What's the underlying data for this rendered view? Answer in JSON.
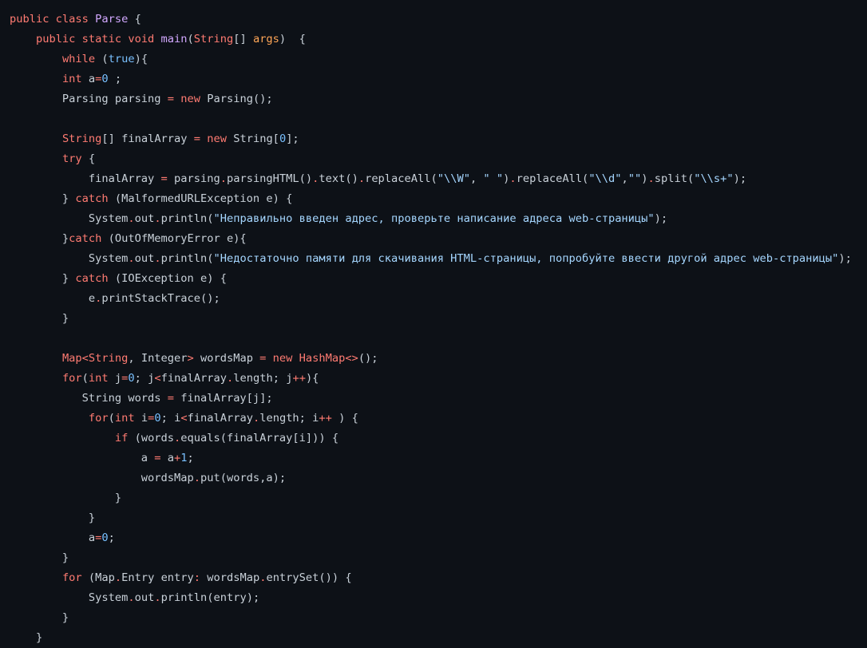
{
  "language": "java",
  "colors": {
    "background": "#0d1117",
    "text": "#c9d1d9",
    "keyword": "#ff7b72",
    "class_name": "#d2a8ff",
    "string": "#a5d6ff",
    "number": "#79c0ff",
    "argument": "#ffa657"
  },
  "lines": [
    [
      [
        "kw",
        "public class "
      ],
      [
        "cls",
        "Parse"
      ],
      [
        "p",
        " {"
      ]
    ],
    [
      [
        "p",
        "    "
      ],
      [
        "kw",
        "public static void "
      ],
      [
        "cls",
        "main"
      ],
      [
        "p",
        "("
      ],
      [
        "kw",
        "String"
      ],
      [
        "p",
        "[] "
      ],
      [
        "arg",
        "args"
      ],
      [
        "p",
        ")  {"
      ]
    ],
    [
      [
        "p",
        "        "
      ],
      [
        "kw",
        "while"
      ],
      [
        "p",
        " ("
      ],
      [
        "num",
        "true"
      ],
      [
        "p",
        "){"
      ]
    ],
    [
      [
        "p",
        "        "
      ],
      [
        "kw",
        "int"
      ],
      [
        "p",
        " a"
      ],
      [
        "kw",
        "="
      ],
      [
        "num",
        "0"
      ],
      [
        "p",
        " ;"
      ]
    ],
    [
      [
        "p",
        "        Parsing parsing "
      ],
      [
        "kw",
        "="
      ],
      [
        "p",
        " "
      ],
      [
        "kw",
        "new"
      ],
      [
        "p",
        " Parsing();"
      ]
    ],
    [],
    [
      [
        "p",
        "        "
      ],
      [
        "kw",
        "String"
      ],
      [
        "p",
        "[] finalArray "
      ],
      [
        "kw",
        "="
      ],
      [
        "p",
        " "
      ],
      [
        "kw",
        "new"
      ],
      [
        "p",
        " String["
      ],
      [
        "num",
        "0"
      ],
      [
        "p",
        "];"
      ]
    ],
    [
      [
        "p",
        "        "
      ],
      [
        "kw",
        "try"
      ],
      [
        "p",
        " {"
      ]
    ],
    [
      [
        "p",
        "            finalArray "
      ],
      [
        "kw",
        "="
      ],
      [
        "p",
        " parsing"
      ],
      [
        "kw",
        "."
      ],
      [
        "p",
        "parsingHTML()"
      ],
      [
        "kw",
        "."
      ],
      [
        "p",
        "text()"
      ],
      [
        "kw",
        "."
      ],
      [
        "p",
        "replaceAll("
      ],
      [
        "str",
        "\"\\\\W\""
      ],
      [
        "p",
        ", "
      ],
      [
        "str",
        "\" \""
      ],
      [
        "p",
        ")"
      ],
      [
        "kw",
        "."
      ],
      [
        "p",
        "replaceAll("
      ],
      [
        "str",
        "\"\\\\d\""
      ],
      [
        "p",
        ","
      ],
      [
        "str",
        "\"\""
      ],
      [
        "p",
        ")"
      ],
      [
        "kw",
        "."
      ],
      [
        "p",
        "split("
      ],
      [
        "str",
        "\"\\\\s+\""
      ],
      [
        "p",
        ");"
      ]
    ],
    [
      [
        "p",
        "        } "
      ],
      [
        "kw",
        "catch"
      ],
      [
        "p",
        " (MalformedURLException e) {"
      ]
    ],
    [
      [
        "p",
        "            System"
      ],
      [
        "kw",
        "."
      ],
      [
        "p",
        "out"
      ],
      [
        "kw",
        "."
      ],
      [
        "p",
        "println("
      ],
      [
        "str",
        "\"Неправильно введен адрес, проверьте написание адреса web-страницы\""
      ],
      [
        "p",
        ");"
      ]
    ],
    [
      [
        "p",
        "        }"
      ],
      [
        "kw",
        "catch"
      ],
      [
        "p",
        " (OutOfMemoryError e){"
      ]
    ],
    [
      [
        "p",
        "            System"
      ],
      [
        "kw",
        "."
      ],
      [
        "p",
        "out"
      ],
      [
        "kw",
        "."
      ],
      [
        "p",
        "println("
      ],
      [
        "str",
        "\"Недостаточно памяти для скачивания HTML-страницы, попробуйте ввести другой адрес web-страницы\""
      ],
      [
        "p",
        ");"
      ]
    ],
    [
      [
        "p",
        "        } "
      ],
      [
        "kw",
        "catch"
      ],
      [
        "p",
        " (IOException e) {"
      ]
    ],
    [
      [
        "p",
        "            e"
      ],
      [
        "kw",
        "."
      ],
      [
        "p",
        "printStackTrace();"
      ]
    ],
    [
      [
        "p",
        "        }"
      ]
    ],
    [],
    [
      [
        "p",
        "        "
      ],
      [
        "kw",
        "Map<String"
      ],
      [
        "p",
        ", Integer"
      ],
      [
        "kw",
        ">"
      ],
      [
        "p",
        " wordsMap "
      ],
      [
        "kw",
        "="
      ],
      [
        "p",
        " "
      ],
      [
        "kw",
        "new HashMap<>"
      ],
      [
        "p",
        "();"
      ]
    ],
    [
      [
        "p",
        "        "
      ],
      [
        "kw",
        "for"
      ],
      [
        "p",
        "("
      ],
      [
        "kw",
        "int"
      ],
      [
        "p",
        " j"
      ],
      [
        "kw",
        "="
      ],
      [
        "num",
        "0"
      ],
      [
        "p",
        "; j"
      ],
      [
        "kw",
        "<"
      ],
      [
        "p",
        "finalArray"
      ],
      [
        "kw",
        "."
      ],
      [
        "p",
        "length; j"
      ],
      [
        "kw",
        "++"
      ],
      [
        "p",
        "){"
      ]
    ],
    [
      [
        "p",
        "           String words "
      ],
      [
        "kw",
        "="
      ],
      [
        "p",
        " finalArray[j];"
      ]
    ],
    [
      [
        "p",
        "            "
      ],
      [
        "kw",
        "for"
      ],
      [
        "p",
        "("
      ],
      [
        "kw",
        "int"
      ],
      [
        "p",
        " i"
      ],
      [
        "kw",
        "="
      ],
      [
        "num",
        "0"
      ],
      [
        "p",
        "; i"
      ],
      [
        "kw",
        "<"
      ],
      [
        "p",
        "finalArray"
      ],
      [
        "kw",
        "."
      ],
      [
        "p",
        "length; i"
      ],
      [
        "kw",
        "++"
      ],
      [
        "p",
        " ) {"
      ]
    ],
    [
      [
        "p",
        "                "
      ],
      [
        "kw",
        "if"
      ],
      [
        "p",
        " (words"
      ],
      [
        "kw",
        "."
      ],
      [
        "p",
        "equals(finalArray[i])) {"
      ]
    ],
    [
      [
        "p",
        "                    a "
      ],
      [
        "kw",
        "="
      ],
      [
        "p",
        " a"
      ],
      [
        "kw",
        "+"
      ],
      [
        "num",
        "1"
      ],
      [
        "p",
        ";"
      ]
    ],
    [
      [
        "p",
        "                    wordsMap"
      ],
      [
        "kw",
        "."
      ],
      [
        "p",
        "put(words,a);"
      ]
    ],
    [
      [
        "p",
        "                }"
      ]
    ],
    [
      [
        "p",
        "            }"
      ]
    ],
    [
      [
        "p",
        "            a"
      ],
      [
        "kw",
        "="
      ],
      [
        "num",
        "0"
      ],
      [
        "p",
        ";"
      ]
    ],
    [
      [
        "p",
        "        }"
      ]
    ],
    [
      [
        "p",
        "        "
      ],
      [
        "kw",
        "for"
      ],
      [
        "p",
        " (Map"
      ],
      [
        "kw",
        "."
      ],
      [
        "p",
        "Entry entry"
      ],
      [
        "kw",
        ":"
      ],
      [
        "p",
        " wordsMap"
      ],
      [
        "kw",
        "."
      ],
      [
        "p",
        "entrySet()) {"
      ]
    ],
    [
      [
        "p",
        "            System"
      ],
      [
        "kw",
        "."
      ],
      [
        "p",
        "out"
      ],
      [
        "kw",
        "."
      ],
      [
        "p",
        "println(entry);"
      ]
    ],
    [
      [
        "p",
        "        }"
      ]
    ],
    [
      [
        "p",
        "    }"
      ]
    ]
  ]
}
